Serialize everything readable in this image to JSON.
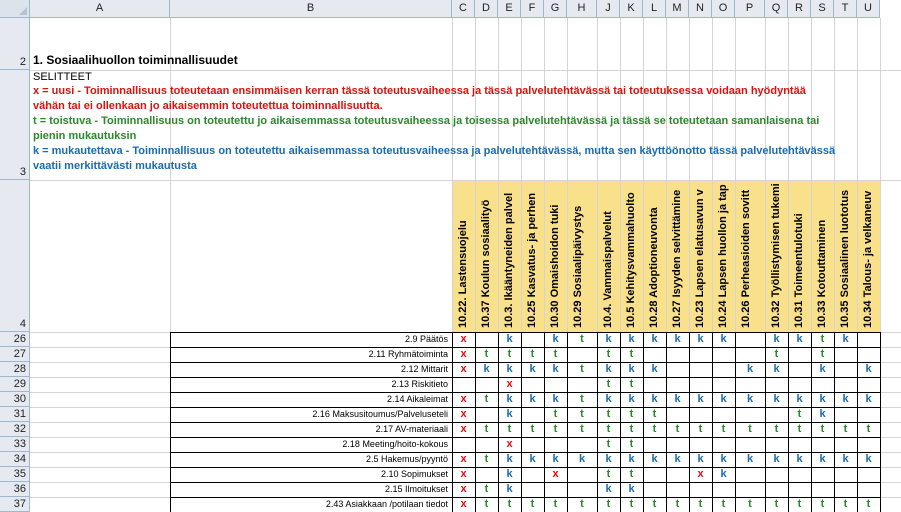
{
  "columns": [
    "A",
    "B",
    "C",
    "D",
    "E",
    "F",
    "G",
    "H",
    "J",
    "K",
    "L",
    "M",
    "N",
    "O",
    "P",
    "Q",
    "R",
    "S",
    "T",
    "U"
  ],
  "row_numbers": [
    "2",
    "3",
    "4",
    "26",
    "27",
    "28",
    "29",
    "30",
    "31",
    "32",
    "33",
    "34",
    "35",
    "36",
    "37"
  ],
  "section_title": "1. Sosiaalihuollon toiminnallisuudet",
  "legend": {
    "heading": "SELITTEET",
    "x_line1": "x = uusi -  Toiminnallisuus toteutetaan ensimmäisen kerran tässä toteutusvaiheessa ja tässä palvelutehtävässä tai toteutuksessa voidaan hyödyntää",
    "x_line2": "vähän tai ei ollenkaan jo aikaisemmin toteutettua toiminnallisuutta.",
    "t_line1": "t =  toistuva -  Toiminnallisuus on toteutettu jo aikaisemmassa toteutusvaiheessa ja toisessa palvelutehtävässä ja tässä se toteutetaan samanlaisena tai",
    "t_line2": "pienin mukautuksin",
    "k_line1": "k = mukautettava - Toiminnallisuus on toteutettu aikaisemmassa toteutusvaiheessa ja palvelutehtävässä, mutta sen käyttöönotto tässä palvelutehtävässä",
    "k_line2": "vaatii merkittävästi mukautusta"
  },
  "vertical_headers": [
    "10.22. Lastensuojelu",
    "10.37 Koulun sosiaalityö",
    "10.3. Ikääntyneiden palvel",
    "10.25 Kasvatus- ja perhen",
    "10.30 Omaishoidon tuki",
    "10.29 Sosiaalipäivystys",
    "10.4. Vammaispalvelut",
    "10.5 Kehitysvammahuolto",
    "10.28 Adoptioneuvonta",
    "10.27 Isyyden selvittämine",
    "10.23 Lapsen elatusavun v",
    "10.24 Lapsen huollon ja tap",
    "10.26 Perheasioiden sovitt",
    "10.32 Työllistymisen tukemi",
    "10.31 Toimeentulotuki",
    "10.33 Kotouttaminen",
    "10.35 Sosiaalinen luototus",
    "10.34 Talous- ja velkaneuv"
  ],
  "rows": [
    {
      "num": "26",
      "label": "2.9 Päätös",
      "marks": [
        "x",
        "",
        "k",
        "",
        "k",
        "t",
        "k",
        "k",
        "k",
        "k",
        "k",
        "k",
        "",
        "k",
        "k",
        "t",
        "k",
        ""
      ]
    },
    {
      "num": "27",
      "label": "2.11 Ryhmätoiminta",
      "marks": [
        "x",
        "t",
        "t",
        "t",
        "t",
        "",
        "t",
        "t",
        "",
        "",
        "",
        "",
        "",
        "t",
        "",
        "t",
        "",
        ""
      ]
    },
    {
      "num": "28",
      "label": "2.12 Mittarit",
      "marks": [
        "x",
        "k",
        "k",
        "k",
        "k",
        "t",
        "k",
        "k",
        "k",
        "",
        "",
        "",
        "k",
        "k",
        "",
        "k",
        "",
        "k"
      ]
    },
    {
      "num": "29",
      "label": "2.13 Riskitieto",
      "marks": [
        "",
        "",
        "x",
        "",
        "",
        "",
        "t",
        "t",
        "",
        "",
        "",
        "",
        "",
        "",
        "",
        "",
        "",
        ""
      ]
    },
    {
      "num": "30",
      "label": "2.14 Aikaleimat",
      "marks": [
        "x",
        "t",
        "k",
        "k",
        "k",
        "t",
        "k",
        "k",
        "k",
        "k",
        "k",
        "k",
        "k",
        "k",
        "k",
        "k",
        "k",
        "k"
      ]
    },
    {
      "num": "31",
      "label": "2.16 Maksusitoumus/Palveluseteli",
      "marks": [
        "x",
        "",
        "k",
        "",
        "t",
        "t",
        "t",
        "t",
        "t",
        "",
        "",
        "",
        "",
        "",
        "t",
        "k",
        "",
        ""
      ]
    },
    {
      "num": "32",
      "label": "2.17 AV-materiaali",
      "marks": [
        "x",
        "t",
        "t",
        "t",
        "t",
        "t",
        "t",
        "t",
        "t",
        "t",
        "t",
        "t",
        "t",
        "t",
        "t",
        "t",
        "t",
        "t"
      ]
    },
    {
      "num": "33",
      "label": "2.18 Meeting/hoito-kokous",
      "marks": [
        "",
        "",
        "x",
        "",
        "",
        "",
        "t",
        "t",
        "",
        "",
        "",
        "",
        "",
        "",
        "",
        "",
        "",
        ""
      ]
    },
    {
      "num": "34",
      "label": "2.5 Hakemus/pyyntö",
      "marks": [
        "x",
        "t",
        "k",
        "k",
        "k",
        "k",
        "k",
        "k",
        "k",
        "k",
        "k",
        "k",
        "k",
        "k",
        "k",
        "k",
        "k",
        "k"
      ]
    },
    {
      "num": "35",
      "label": "2.10 Sopimukset",
      "marks": [
        "x",
        "",
        "k",
        "",
        "x",
        "",
        "t",
        "t",
        "",
        "",
        "x",
        "k",
        "",
        "",
        "",
        "",
        "",
        ""
      ]
    },
    {
      "num": "36",
      "label": "2.15 Ilmoitukset",
      "marks": [
        "x",
        "t",
        "k",
        "",
        "",
        "",
        "k",
        "k",
        "",
        "",
        "",
        "",
        "",
        "",
        "",
        "",
        "",
        ""
      ]
    },
    {
      "num": "37",
      "label": "2.43 Asiakkaan /potilaan tiedot",
      "marks": [
        "x",
        "t",
        "t",
        "t",
        "t",
        "t",
        "t",
        "t",
        "t",
        "t",
        "t",
        "t",
        "t",
        "t",
        "t",
        "t",
        "t",
        "t"
      ]
    }
  ],
  "colors": {
    "new": "#e01010",
    "repeat": "#2a8a2a",
    "adapt": "#1a6bb0",
    "header_bg": "#e6eaf0",
    "row4_bg": "#f9e08b"
  }
}
